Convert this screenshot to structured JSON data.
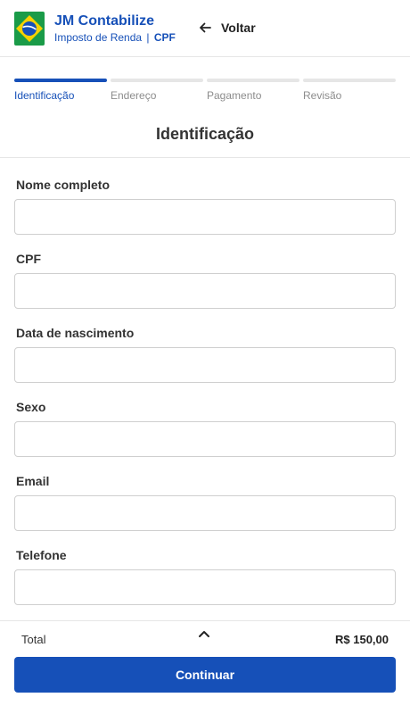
{
  "header": {
    "brand_title": "JM Contabilize",
    "brand_subtitle": "Imposto de Renda",
    "brand_separator": "|",
    "brand_tag": "CPF",
    "back_label": "Voltar",
    "logo_icon": "brazil-flag-icon",
    "back_icon": "arrow-left-icon"
  },
  "steps": [
    {
      "label": "Identificação",
      "active": true
    },
    {
      "label": "Endereço",
      "active": false
    },
    {
      "label": "Pagamento",
      "active": false
    },
    {
      "label": "Revisão",
      "active": false
    }
  ],
  "section_title": "Identificação",
  "form": {
    "fields": [
      {
        "label": "Nome completo",
        "value": "",
        "placeholder": ""
      },
      {
        "label": "CPF",
        "value": "",
        "placeholder": ""
      },
      {
        "label": "Data de nascimento",
        "value": "",
        "placeholder": ""
      },
      {
        "label": "Sexo",
        "value": "",
        "placeholder": ""
      },
      {
        "label": "Email",
        "value": "",
        "placeholder": ""
      },
      {
        "label": "Telefone",
        "value": "",
        "placeholder": ""
      }
    ]
  },
  "footer": {
    "total_label": "Total",
    "total_value": "R$ 150,00",
    "continue_label": "Continuar",
    "toggle_icon": "chevron-up-icon"
  },
  "colors": {
    "primary": "#1650b8",
    "step_inactive": "#e6e6e6",
    "flag_green": "#1a9b48",
    "flag_yellow": "#f5d100",
    "flag_blue": "#1650b8"
  }
}
